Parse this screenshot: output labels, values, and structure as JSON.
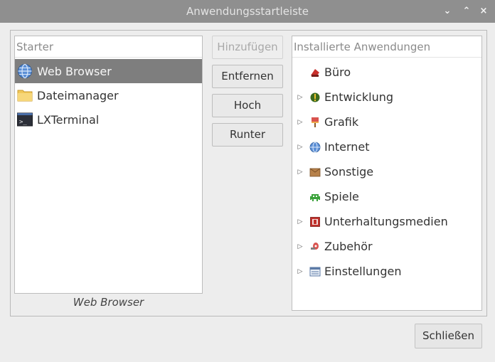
{
  "window": {
    "title": "Anwendungsstartleiste",
    "controls": {
      "minimize": "⌄",
      "maximize": "⌃",
      "close": "×"
    }
  },
  "starter": {
    "header": "Starter",
    "items": [
      {
        "label": "Web Browser",
        "icon": "globe-icon",
        "selected": true
      },
      {
        "label": "Dateimanager",
        "icon": "folder-icon",
        "selected": false
      },
      {
        "label": "LXTerminal",
        "icon": "terminal-icon",
        "selected": false
      }
    ],
    "caption": "Web Browser"
  },
  "actions": {
    "add": "Hinzufügen",
    "remove": "Entfernen",
    "up": "Hoch",
    "down": "Runter"
  },
  "installed": {
    "header": "Installierte Anwendungen",
    "items": [
      {
        "label": "Büro",
        "icon": "office-icon",
        "expandable": false
      },
      {
        "label": "Entwicklung",
        "icon": "development-icon",
        "expandable": true
      },
      {
        "label": "Grafik",
        "icon": "graphics-icon",
        "expandable": true
      },
      {
        "label": "Internet",
        "icon": "internet-icon",
        "expandable": true
      },
      {
        "label": "Sonstige",
        "icon": "other-icon",
        "expandable": true
      },
      {
        "label": "Spiele",
        "icon": "games-icon",
        "expandable": false
      },
      {
        "label": "Unterhaltungsmedien",
        "icon": "multimedia-icon",
        "expandable": true
      },
      {
        "label": "Zubehör",
        "icon": "accessories-icon",
        "expandable": true
      },
      {
        "label": "Einstellungen",
        "icon": "settings-icon",
        "expandable": true
      }
    ]
  },
  "footer": {
    "close": "Schließen"
  },
  "colors": {
    "titlebar": "#8f8f8f",
    "selection": "#7e7e7e",
    "window_bg": "#ededed"
  }
}
